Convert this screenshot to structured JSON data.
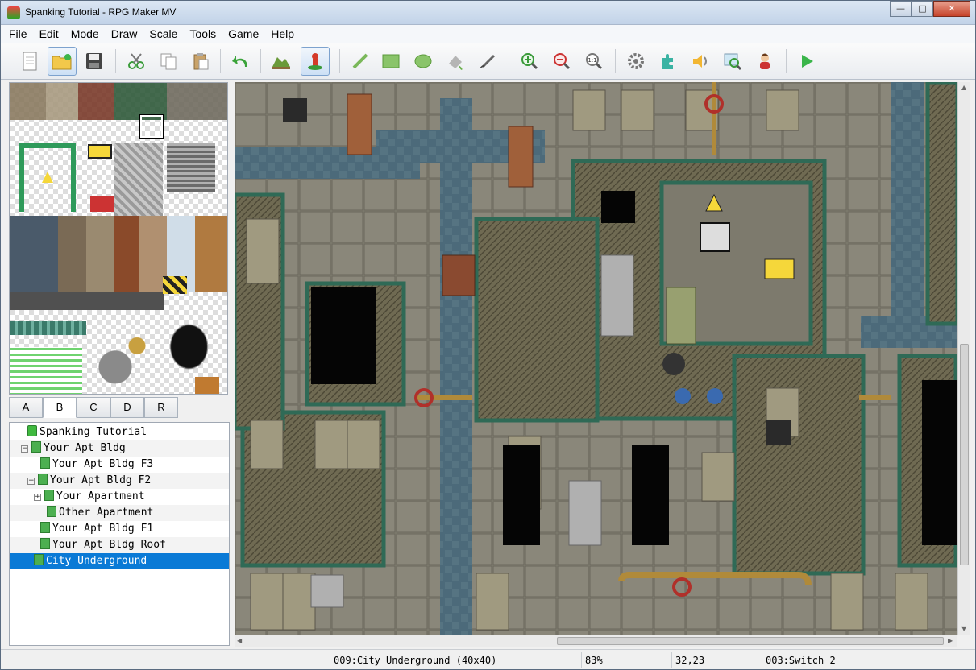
{
  "window": {
    "title": "Spanking Tutorial - RPG Maker MV"
  },
  "menu": [
    "File",
    "Edit",
    "Mode",
    "Draw",
    "Scale",
    "Tools",
    "Game",
    "Help"
  ],
  "toolbar": {
    "icons": [
      "new-project-icon",
      "open-project-icon",
      "save-project-icon",
      "cut-icon",
      "copy-icon",
      "paste-icon",
      "undo-icon",
      "map-mode-icon",
      "event-mode-icon",
      "pencil-icon",
      "rectangle-icon",
      "ellipse-icon",
      "fill-icon",
      "shadow-pen-icon",
      "zoom-in-icon",
      "zoom-out-icon",
      "actual-size-icon",
      "database-icon",
      "plugin-manager-icon",
      "sound-test-icon",
      "event-searcher-icon",
      "character-generator-icon",
      "playtest-icon"
    ]
  },
  "tileset_tabs": [
    "A",
    "B",
    "C",
    "D",
    "R"
  ],
  "selected_tab": "B",
  "map_tree": [
    {
      "label": "Spanking Tutorial",
      "level": 0,
      "type": "project"
    },
    {
      "label": "Your Apt Bldg",
      "level": 1,
      "expander": "−"
    },
    {
      "label": "Your Apt Bldg F3",
      "level": 2
    },
    {
      "label": "Your Apt Bldg F2",
      "level": 2,
      "expander": "−"
    },
    {
      "label": "Your Apartment",
      "level": 3,
      "expander": "+"
    },
    {
      "label": "Other Apartment",
      "level": 3
    },
    {
      "label": "Your Apt Bldg F1",
      "level": 2
    },
    {
      "label": "Your Apt Bldg Roof",
      "level": 2
    },
    {
      "label": "City Underground",
      "level": 1,
      "selected": true
    }
  ],
  "status": {
    "map": "009:City Underground (40x40)",
    "zoom": "83%",
    "coords": "32,23",
    "switch": "003:Switch 2"
  }
}
